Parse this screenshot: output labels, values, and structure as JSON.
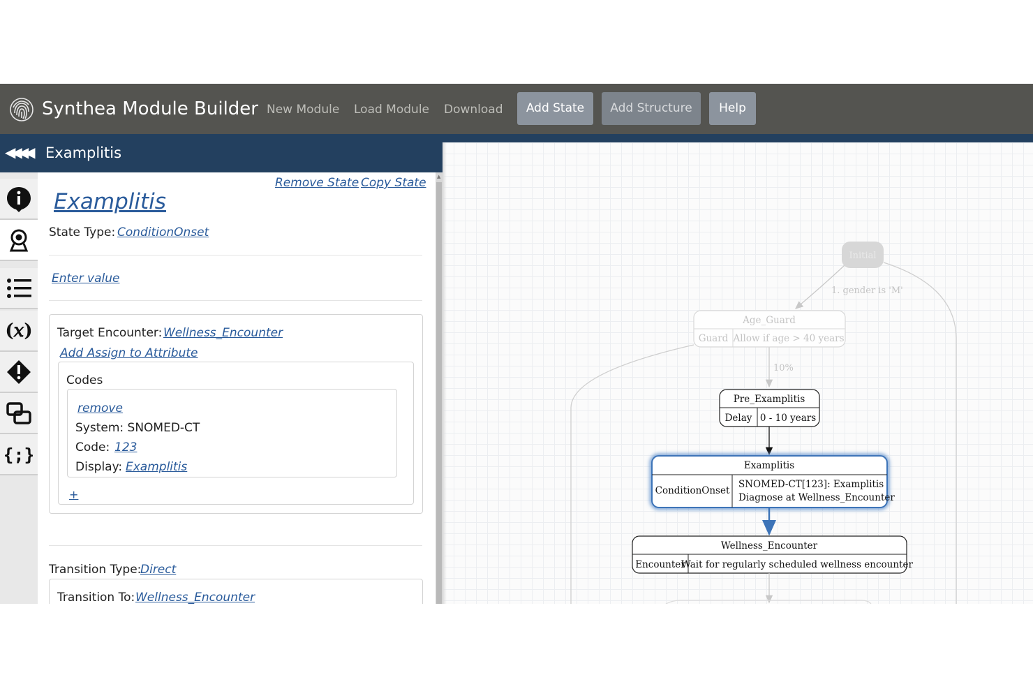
{
  "app": {
    "title": "Synthea Module Builder",
    "nav": {
      "new_module": "New Module",
      "load_module": "Load Module",
      "download": "Download",
      "add_state": "Add State",
      "add_structure": "Add Structure",
      "help": "Help"
    }
  },
  "panel": {
    "collapse_icon": "collapse-left-arrows",
    "title": "Examplitis"
  },
  "rail": {
    "items": [
      "info-icon",
      "condition-onset-icon",
      "list-icon",
      "variable-icon",
      "warning-icon",
      "transition-icon",
      "json-icon"
    ]
  },
  "editor": {
    "remove_state": "Remove State",
    "copy_state": "Copy State",
    "state_name": "Examplitis",
    "state_type_label": "State Type:",
    "state_type_value": "ConditionOnset",
    "enter_value": "Enter value",
    "target_encounter_label": "Target Encounter:",
    "target_encounter_value": "Wellness_Encounter",
    "add_assign": "Add Assign to Attribute",
    "codes_label": "Codes",
    "code": {
      "remove": "remove",
      "system_text": "System: SNOMED-CT",
      "code_label": "Code:",
      "code_value": "123",
      "display_label": "Display:",
      "display_value": "Examplitis"
    },
    "add_code": "+",
    "transition_type_label": "Transition Type:",
    "transition_type_value": "Direct",
    "transition_to_label": "Transition To:",
    "transition_to_value": "Wellness_Encounter"
  },
  "graph": {
    "initial": {
      "name": "Initial"
    },
    "edge_gender": "1. gender is 'M'",
    "age_guard": {
      "name": "Age_Guard",
      "type": "Guard",
      "detail": "Allow if age > 40 years"
    },
    "edge_pct": "10%",
    "pre": {
      "name": "Pre_Examplitis",
      "type": "Delay",
      "detail": "0 - 10 years"
    },
    "selected": {
      "name": "Examplitis",
      "type": "ConditionOnset",
      "detail1": "SNOMED-CT[123]: Examplitis",
      "detail2": "Diagnose at Wellness_Encounter"
    },
    "wellness": {
      "name": "Wellness_Encounter",
      "type": "Encounter",
      "detail": "Wait for regularly scheduled wellness encounter"
    }
  },
  "colors": {
    "topbar": "#545450",
    "panel_header": "#23405f",
    "link": "#2a5b9b",
    "selected_node": "#3d74b8"
  }
}
